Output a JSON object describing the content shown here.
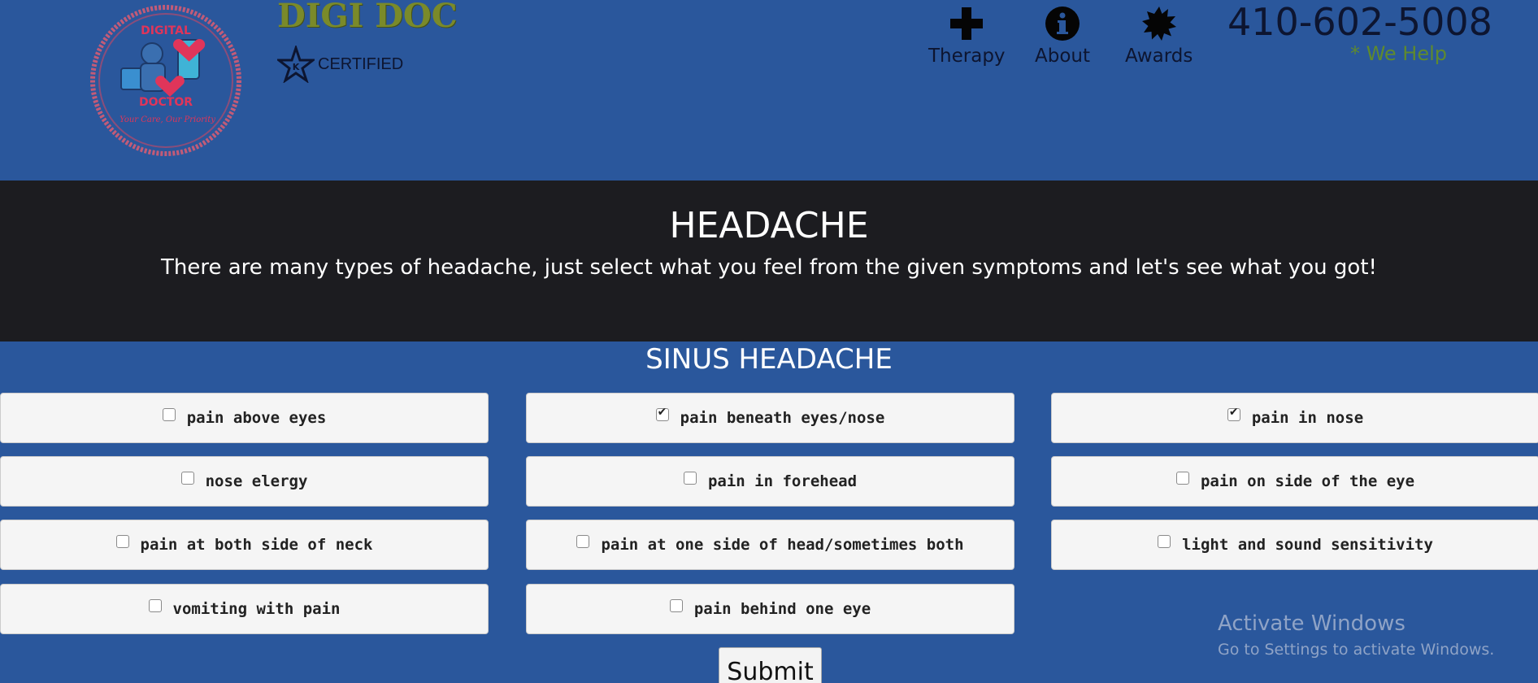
{
  "header": {
    "brand": "DIGI DOC",
    "certified": "CERTIFIED",
    "logo_text": {
      "top": "DIGITAL",
      "bottom": "DOCTOR",
      "tagline": "Your Care, Our Priority"
    },
    "nav": [
      {
        "label": "Therapy",
        "icon": "plus-icon"
      },
      {
        "label": "About",
        "icon": "info-icon"
      },
      {
        "label": "Awards",
        "icon": "starburst-icon"
      }
    ],
    "phone": "410-602-5008",
    "tagline": "* We Help"
  },
  "banner": {
    "title": "HEADACHE",
    "subtitle": "There are many types of headache, just select what you feel from the given symptoms and let's see what you got!"
  },
  "section": {
    "title": "SINUS HEADACHE",
    "options": [
      {
        "label": "pain above eyes",
        "checked": false
      },
      {
        "label": "pain beneath eyes/nose",
        "checked": true
      },
      {
        "label": "pain in nose",
        "checked": true
      },
      {
        "label": "nose elergy",
        "checked": false
      },
      {
        "label": "pain in forehead",
        "checked": false
      },
      {
        "label": "pain on side of the eye",
        "checked": false
      },
      {
        "label": "pain at both side of neck",
        "checked": false
      },
      {
        "label": "pain at one side of head/sometimes both",
        "checked": false
      },
      {
        "label": "light and sound sensitivity",
        "checked": false
      },
      {
        "label": "vomiting with pain",
        "checked": false
      },
      {
        "label": "pain behind one eye",
        "checked": false
      }
    ],
    "submit_label": "Submit"
  },
  "watermark": {
    "title": "Activate Windows",
    "subtitle": "Go to Settings to activate Windows."
  },
  "colors": {
    "page_bg": "#2a579c",
    "banner_bg": "#1c1c20",
    "brand": "#7a8a2a",
    "we_help": "#5f8a2e"
  }
}
